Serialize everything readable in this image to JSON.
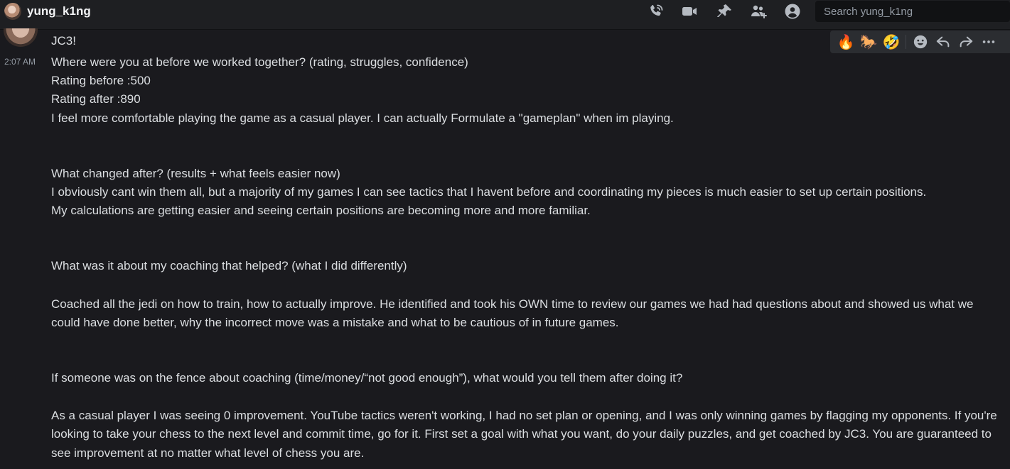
{
  "header": {
    "title": "yung_k1ng",
    "search_placeholder": "Search yung_k1ng",
    "icons": [
      "phone-call-icon",
      "video-icon",
      "pin-icon",
      "add-friend-icon",
      "profile-icon"
    ]
  },
  "message": {
    "previous_line": "JC3!",
    "timestamp": "2:07 AM",
    "paragraphs": {
      "q1": "Where were you at before we worked together? (rating, struggles, confidence)",
      "r_before": "Rating before :500",
      "r_after": "Rating after :890",
      "a1": "I feel more comfortable playing the game as a casual player. I can actually Formulate a \"gameplan\" when im playing.",
      "q2": "What changed after? (results + what feels easier now)",
      "a2a": "I obviously cant win them all, but a majority of my games I can see tactics that I havent before and coordinating my pieces is much easier to set up certain positions.",
      "a2b": "My calculations are getting easier and seeing certain positions are becoming more and more familiar.",
      "q3": "What was it about my coaching that helped? (what I did differently)",
      "a3": "Coached all the jedi on how to train, how to actually improve. He identified and took his OWN time to review our games we had had questions about and showed us what we could have done better, why the incorrect move was a mistake and what to be cautious of in future games.",
      "q4": "If someone was on the fence about coaching (time/money/“not good enough”), what would you tell them after doing it?",
      "a4": "As a casual player I was seeing 0 improvement. YouTube tactics weren't working, I had no set plan or opening, and I was only winning games by flagging my opponents. If you're looking to take your chess to the next level and commit time, go for it. First set a goal with what you want, do your daily puzzles, and get coached by JC3. You are guaranteed to see improvement at no matter what level of chess you are."
    }
  },
  "toolbar": {
    "reactions": [
      "🔥",
      "🐎",
      "🤣"
    ],
    "actions": [
      "add-reaction-icon",
      "reply-icon",
      "forward-icon",
      "more-icon"
    ]
  },
  "colors": {
    "background": "#1a1a1e",
    "header": "#1e1f22",
    "text": "#dbdee1",
    "muted": "#949ba4",
    "toolbar": "#2b2d31"
  }
}
